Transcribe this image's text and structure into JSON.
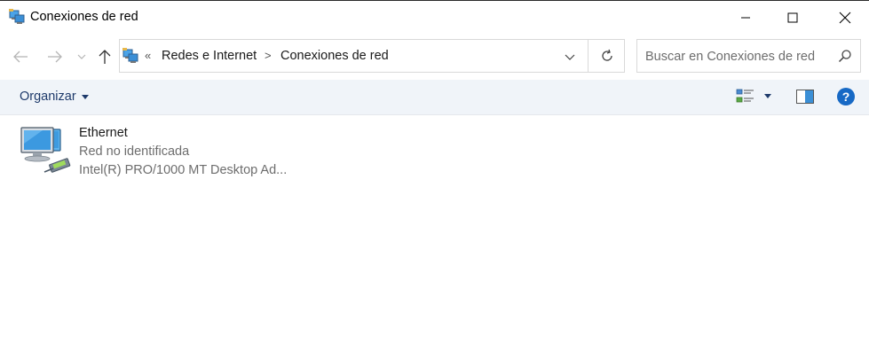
{
  "window": {
    "title": "Conexiones de red",
    "icon": "network-connections-icon"
  },
  "navigation": {
    "back_icon": "back-arrow-icon",
    "forward_icon": "forward-arrow-icon",
    "recent_icon": "chevron-down-icon",
    "up_icon": "up-arrow-icon"
  },
  "address": {
    "overflow": "«",
    "breadcrumbs": [
      "Redes e Internet",
      "Conexiones de red"
    ],
    "separator": ">"
  },
  "search": {
    "placeholder": "Buscar en Conexiones de red",
    "value": ""
  },
  "commandbar": {
    "organize_label": "Organizar",
    "help_label": "?"
  },
  "connections": [
    {
      "name": "Ethernet",
      "status": "Red no identificada",
      "device": "Intel(R) PRO/1000 MT Desktop Ad...",
      "icon": "ethernet-adapter-icon"
    }
  ],
  "colors": {
    "accent": "#1769c5",
    "commandbar_bg": "#f0f4f9",
    "organize_text": "#1e3a6b",
    "secondary_text": "#6d6d6d"
  }
}
